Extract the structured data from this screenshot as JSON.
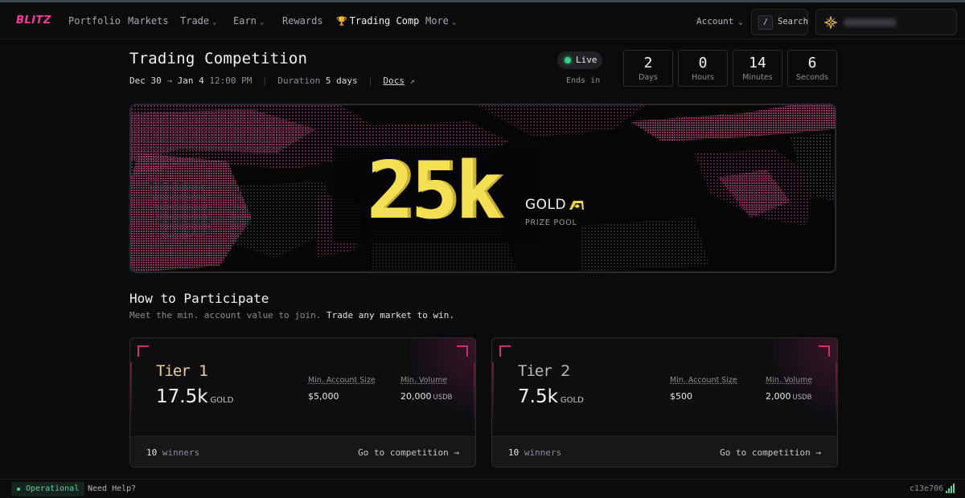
{
  "nav": {
    "logo": "BLITZ",
    "items": [
      {
        "label": "Portfolio",
        "dropdown": false
      },
      {
        "label": "Markets",
        "dropdown": false
      },
      {
        "label": "Trade",
        "dropdown": true
      },
      {
        "label": "Earn",
        "dropdown": true
      },
      {
        "label": "Rewards",
        "dropdown": false
      },
      {
        "label": "Trading Comp",
        "dropdown": false,
        "icon": "trophy-icon",
        "active": true
      },
      {
        "label": "More",
        "dropdown": true
      }
    ],
    "account_label": "Account",
    "search_key": "/",
    "search_label": "Search"
  },
  "header": {
    "title": "Trading Competition",
    "start_date": "Dec 30",
    "end_date": "Jan 4",
    "end_time": "12:00 PM",
    "duration_label": "Duration",
    "duration_value": "5 days",
    "docs_label": "Docs",
    "status": "Live",
    "ends_in_label": "Ends in",
    "countdown": [
      {
        "value": "2",
        "label": "Days"
      },
      {
        "value": "0",
        "label": "Hours"
      },
      {
        "value": "14",
        "label": "Minutes"
      },
      {
        "value": "6",
        "label": "Seconds"
      }
    ]
  },
  "banner": {
    "amount": "25k",
    "currency": "GOLD",
    "caption": "PRIZE POOL"
  },
  "participate": {
    "title": "How to Participate",
    "subtitle_muted": "Meet the min. account value to join.",
    "subtitle_bright": "Trade any market to win."
  },
  "tiers": [
    {
      "word": "Tier",
      "number": "1",
      "amount": "17.5k",
      "unit": "GOLD",
      "min_account_label": "Min. Account Size",
      "min_account_value": "$5,000",
      "min_volume_label": "Min. Volume",
      "min_volume_value": "20,000",
      "min_volume_unit": "USDB",
      "winners_count": "10",
      "winners_label": "winners",
      "cta": "Go to competition →",
      "accent": "#e8cf9a"
    },
    {
      "word": "Tier",
      "number": "2",
      "amount": "7.5k",
      "unit": "GOLD",
      "min_account_label": "Min. Account Size",
      "min_account_value": "$500",
      "min_volume_label": "Min. Volume",
      "min_volume_value": "2,000",
      "min_volume_unit": "USDB",
      "winners_count": "10",
      "winners_label": "winners",
      "cta": "Go to competition →",
      "accent": "#b8b8be"
    }
  ],
  "footer": {
    "status": "Operational",
    "help": "Need Help?",
    "build": "c13e706"
  },
  "colors": {
    "brand": "#ee3f9a",
    "prize": "#f5df55",
    "live": "#35d07f",
    "corner": "#c2356f"
  }
}
